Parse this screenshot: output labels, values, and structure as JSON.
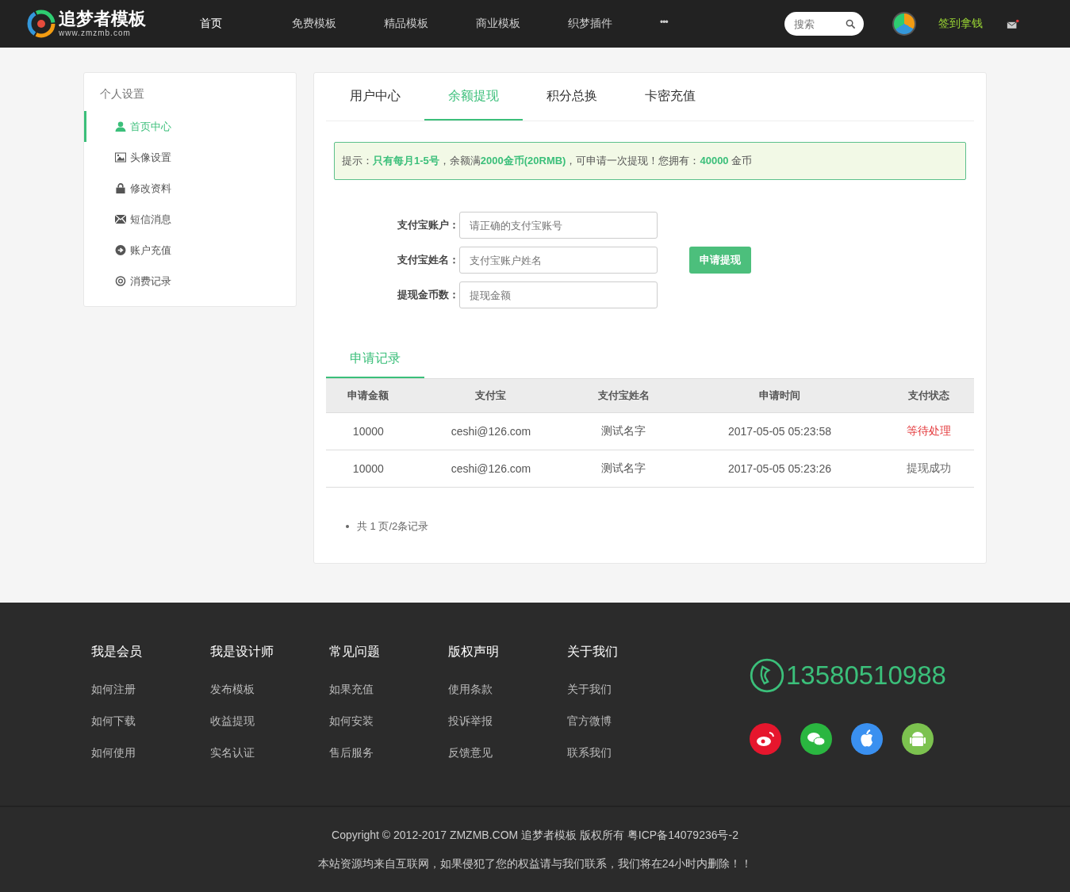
{
  "header": {
    "logo_title": "追梦者模板",
    "logo_url": "www.zmzmb.com",
    "nav": [
      {
        "label": "首页",
        "selected": true
      },
      {
        "label": "免费模板",
        "selected": false
      },
      {
        "label": "精品模板",
        "selected": false
      },
      {
        "label": "商业模板",
        "selected": false
      },
      {
        "label": "织梦插件",
        "selected": false
      }
    ],
    "more": "•••",
    "search": {
      "placeholder": "搜索"
    },
    "signin": "签到拿钱",
    "mail_unread": true
  },
  "sidebar": {
    "title": "个人设置",
    "items": [
      {
        "label": "首页中心",
        "selected": true
      },
      {
        "label": "头像设置",
        "selected": false
      },
      {
        "label": "修改资料",
        "selected": false
      },
      {
        "label": "短信消息",
        "selected": false
      },
      {
        "label": "账户充值",
        "selected": false
      },
      {
        "label": "消费记录",
        "selected": false
      }
    ]
  },
  "tabs": [
    {
      "label": "用户中心",
      "selected": false
    },
    {
      "label": "余额提现",
      "selected": true
    },
    {
      "label": "积分总换",
      "selected": false
    },
    {
      "label": "卡密充值",
      "selected": false
    }
  ],
  "notice": "提示：**只有每月1-5号**，余额满**2000金币(20RMB)**，可申请一次提现！您拥有：**40000** 金币",
  "form": {
    "fields": [
      {
        "label": "支付宝账户：",
        "placeholder": "请正确的支付宝账号"
      },
      {
        "label": "支付宝姓名：",
        "placeholder": "支付宝账户姓名"
      },
      {
        "label": "提现金币数：",
        "placeholder": "提现金额"
      }
    ],
    "submit": "申请提现"
  },
  "records": {
    "tab": "申请记录",
    "columns": [
      "申请金额",
      "支付宝",
      "支付宝姓名",
      "申请时间",
      "支付状态"
    ],
    "rows": [
      {
        "cells": [
          "10000",
          "ceshi@126.com",
          "测试名字",
          "2017-05-05 05:23:58",
          "等待处理"
        ],
        "color": "#e4393c"
      },
      {
        "cells": [
          "10000",
          "ceshi@126.com",
          "测试名字",
          "2017-05-05 05:23:26",
          "提现成功"
        ],
        "color": "#666666"
      }
    ],
    "pagination": "共 1 页/2条记录"
  },
  "footer": {
    "columns": [
      {
        "title": "我是会员",
        "links": [
          "如何注册",
          "如何下载",
          "如何使用"
        ]
      },
      {
        "title": "我是设计师",
        "links": [
          "发布模板",
          "收益提现",
          "实名认证"
        ]
      },
      {
        "title": "常见问题",
        "links": [
          "如果充值",
          "如何安装",
          "售后服务"
        ]
      },
      {
        "title": "版权声明",
        "links": [
          "使用条款",
          "投诉举报",
          "反馈意见"
        ]
      },
      {
        "title": "关于我们",
        "links": [
          "关于我们",
          "官方微博",
          "联系我们"
        ]
      }
    ],
    "phone": "13580510988",
    "copyright": "Copyright © 2012-2017 ZMZMB.COM 追梦者模板 版权所有 粤ICP备14079236号-2",
    "disclaimer": "本站资源均来自互联网，如果侵犯了您的权益请与我们联系，我们将在24小时内删除！！"
  }
}
